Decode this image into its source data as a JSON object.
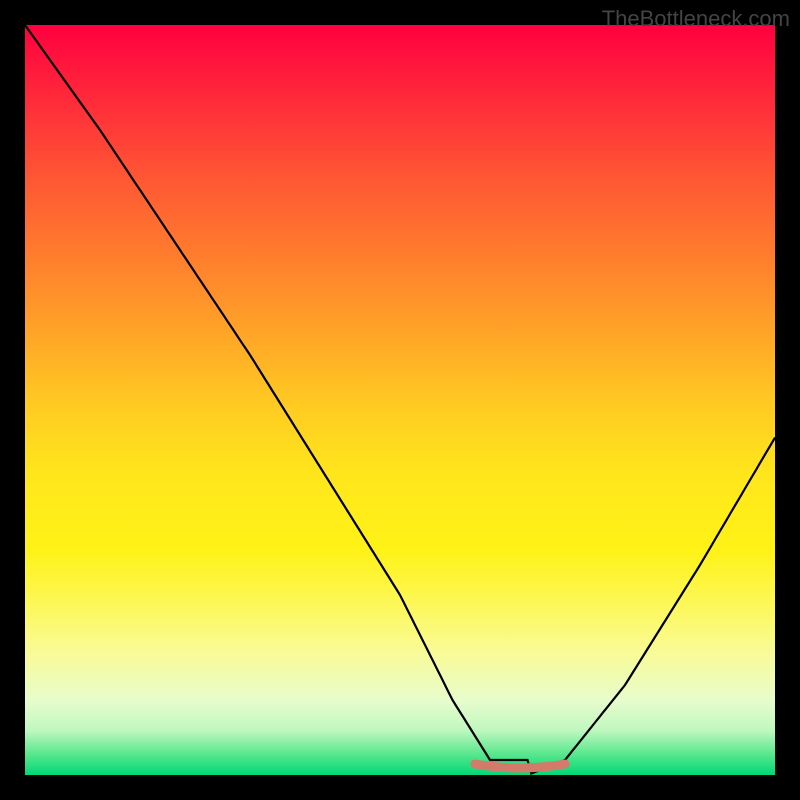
{
  "watermark": "TheBottleneck.com",
  "chart_data": {
    "type": "line",
    "title": "",
    "xlabel": "",
    "ylabel": "",
    "xlim": [
      0,
      100
    ],
    "ylim": [
      0,
      100
    ],
    "series": [
      {
        "name": "bottleneck-curve",
        "x": [
          0,
          10,
          20,
          30,
          40,
          50,
          57,
          62,
          67,
          72,
          80,
          90,
          100
        ],
        "values": [
          100,
          86,
          71,
          56,
          40,
          24,
          10,
          2,
          0,
          2,
          12,
          28,
          45
        ]
      }
    ],
    "markers": [
      {
        "name": "optimal-range",
        "x_start": 60,
        "x_end": 72,
        "y": 0
      }
    ],
    "gradient_stops": [
      {
        "pos": 0,
        "color": "#ff0040"
      },
      {
        "pos": 50,
        "color": "#ffc822"
      },
      {
        "pos": 78,
        "color": "#fcf860"
      },
      {
        "pos": 100,
        "color": "#00d877"
      }
    ]
  }
}
